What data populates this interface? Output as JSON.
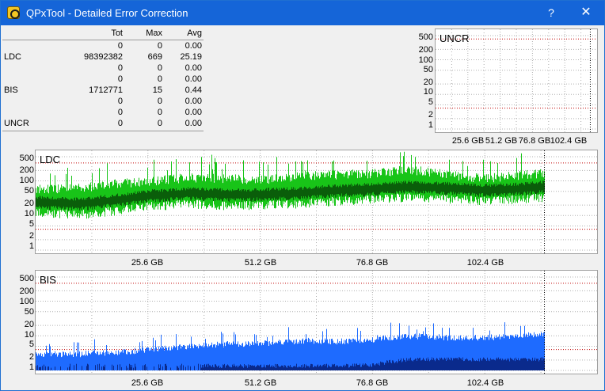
{
  "window": {
    "title": "QPxTool - Detailed Error Correction",
    "help_label": "?",
    "close_label": "✕"
  },
  "stats": {
    "headers": [
      "Tot",
      "Max",
      "Avg"
    ],
    "rows": [
      {
        "label": "",
        "tot": "0",
        "max": "0",
        "avg": "0.00"
      },
      {
        "label": "LDC",
        "tot": "98392382",
        "max": "669",
        "avg": "25.19"
      },
      {
        "label": "",
        "tot": "0",
        "max": "0",
        "avg": "0.00"
      },
      {
        "label": "",
        "tot": "0",
        "max": "0",
        "avg": "0.00"
      },
      {
        "label": "BIS",
        "tot": "1712771",
        "max": "15",
        "avg": "0.44"
      },
      {
        "label": "",
        "tot": "0",
        "max": "0",
        "avg": "0.00"
      },
      {
        "label": "",
        "tot": "0",
        "max": "0",
        "avg": "0.00"
      },
      {
        "label": "UNCR",
        "tot": "0",
        "max": "0",
        "avg": "0.00"
      }
    ]
  },
  "colors": {
    "ldc_light": "#18c418",
    "ldc_dark": "#0a5e0a",
    "bis_light": "#1e6bff",
    "bis_dark": "#0a2a8c",
    "limit_line": "#c00000",
    "grid": "#b0b0b0"
  },
  "chart_data": [
    {
      "type": "area",
      "title": "UNCR",
      "y_scale": "log",
      "y_ticks": [
        "500",
        "200",
        "100",
        "50",
        "20",
        "10",
        "5",
        "2",
        "1"
      ],
      "x_ticks": [
        "25.6 GB",
        "51.2 GB",
        "76.8 GB",
        "102.4 GB"
      ],
      "xlim": [
        0,
        128
      ],
      "ylim": [
        1,
        500
      ],
      "series": [
        {
          "values": []
        }
      ]
    },
    {
      "type": "area",
      "title": "LDC",
      "y_scale": "log",
      "y_ticks": [
        "500",
        "200",
        "100",
        "50",
        "20",
        "10",
        "5",
        "2",
        "1"
      ],
      "x_ticks": [
        "25.6 GB",
        "51.2 GB",
        "76.8 GB",
        "102.4 GB"
      ],
      "xlim": [
        0,
        128
      ],
      "ylim": [
        1,
        500
      ],
      "series": [
        {
          "x": [
            0,
            10,
            20,
            25.6,
            35,
            45,
            51.2,
            60,
            70,
            76.8,
            85,
            95,
            102.4,
            110,
            116
          ],
          "values": [
            25,
            22,
            30,
            38,
            45,
            40,
            42,
            45,
            55,
            60,
            70,
            62,
            55,
            60,
            70
          ]
        },
        {
          "x": [
            0,
            10,
            20,
            25.6,
            35,
            45,
            51.2,
            60,
            70,
            76.8,
            85,
            95,
            102.4,
            110,
            116
          ],
          "values": [
            60,
            65,
            90,
            100,
            130,
            120,
            110,
            140,
            160,
            170,
            220,
            150,
            120,
            150,
            170
          ]
        }
      ]
    },
    {
      "type": "area",
      "title": "BIS",
      "y_scale": "log",
      "y_ticks": [
        "500",
        "200",
        "100",
        "50",
        "20",
        "10",
        "5",
        "2",
        "1"
      ],
      "x_ticks": [
        "25.6 GB",
        "51.2 GB",
        "76.8 GB",
        "102.4 GB"
      ],
      "xlim": [
        0,
        128
      ],
      "ylim": [
        1,
        500
      ],
      "series": [
        {
          "x": [
            0,
            10,
            20,
            25.6,
            35,
            45,
            51.2,
            60,
            70,
            76.8,
            85,
            95,
            102.4,
            110,
            116
          ],
          "values": [
            3,
            3,
            3.5,
            4,
            5,
            6,
            6,
            7,
            7,
            8,
            10,
            9,
            9,
            10,
            12
          ]
        },
        {
          "x": [
            0,
            10,
            20,
            25.6,
            35,
            45,
            51.2,
            60,
            70,
            76.8,
            85,
            95,
            102.4,
            110,
            116
          ],
          "values": [
            1,
            1,
            1,
            1,
            1,
            1.2,
            1.2,
            1.3,
            1.3,
            1.4,
            2,
            2,
            2,
            2,
            2
          ]
        }
      ]
    }
  ]
}
